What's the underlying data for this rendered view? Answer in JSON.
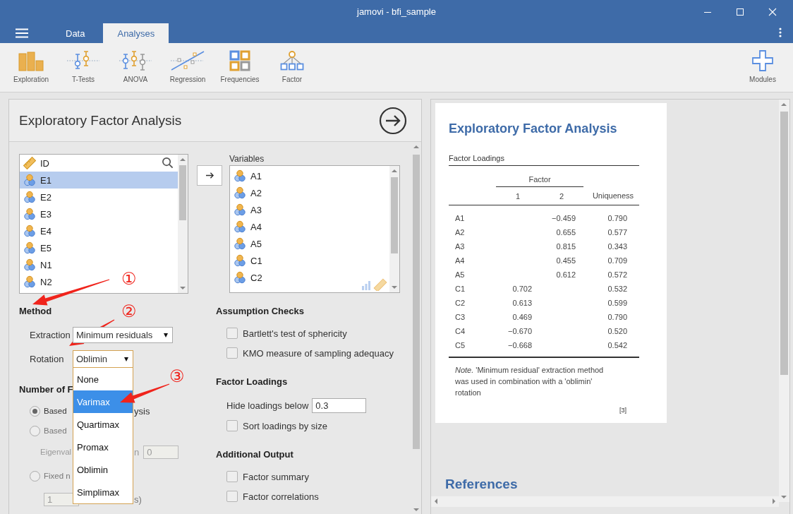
{
  "window": {
    "title": "jamovi - bfi_sample"
  },
  "menu_tabs": [
    {
      "label": "Data",
      "selected": false
    },
    {
      "label": "Analyses",
      "selected": true
    }
  ],
  "ribbon": [
    {
      "label": "Exploration",
      "kind": "exploration"
    },
    {
      "label": "T-Tests",
      "kind": "ttests"
    },
    {
      "label": "ANOVA",
      "kind": "anova"
    },
    {
      "label": "Regression",
      "kind": "regression"
    },
    {
      "label": "Frequencies",
      "kind": "frequencies"
    },
    {
      "label": "Factor",
      "kind": "factor"
    }
  ],
  "modules": {
    "label": "Modules"
  },
  "options_panel": {
    "title": "Exploratory Factor Analysis",
    "available_variables": [
      {
        "name": "ID",
        "kind": "id",
        "selected": false
      },
      {
        "name": "E1",
        "kind": "ordinal",
        "selected": true
      },
      {
        "name": "E2",
        "kind": "ordinal",
        "selected": false
      },
      {
        "name": "E3",
        "kind": "ordinal",
        "selected": false
      },
      {
        "name": "E4",
        "kind": "ordinal",
        "selected": false
      },
      {
        "name": "E5",
        "kind": "ordinal",
        "selected": false
      },
      {
        "name": "N1",
        "kind": "ordinal",
        "selected": false
      },
      {
        "name": "N2",
        "kind": "ordinal",
        "selected": false
      }
    ],
    "variables_label": "Variables",
    "variables": [
      {
        "name": "A1"
      },
      {
        "name": "A2"
      },
      {
        "name": "A3"
      },
      {
        "name": "A4"
      },
      {
        "name": "A5"
      },
      {
        "name": "C1"
      },
      {
        "name": "C2"
      }
    ],
    "method": {
      "heading": "Method",
      "extraction_label": "Extraction",
      "extraction_value": "Minimum residuals",
      "rotation_label": "Rotation",
      "rotation_value": "Oblimin",
      "rotation_options": [
        {
          "label": "None",
          "selected": false
        },
        {
          "label": "Varimax",
          "selected": true
        },
        {
          "label": "Quartimax",
          "selected": false
        },
        {
          "label": "Promax",
          "selected": false
        },
        {
          "label": "Oblimin",
          "selected": false
        },
        {
          "label": "Simplimax",
          "selected": false
        }
      ]
    },
    "number_of_factors": {
      "heading": "Number of F",
      "radios": [
        {
          "label": "Based",
          "tail": "ysis",
          "selected": true
        },
        {
          "label": "Based",
          "selected": false
        }
      ],
      "eigen": {
        "label": "Eigenval",
        "tail": "n",
        "value": "0"
      },
      "fixed": {
        "label": "Fixed n",
        "selected": false
      },
      "fixed_count": {
        "value": "1",
        "tail": "s)"
      }
    },
    "assumption_checks": {
      "heading": "Assumption Checks",
      "items": [
        {
          "label": "Bartlett's test of sphericity",
          "checked": false
        },
        {
          "label": "KMO measure of sampling adequacy",
          "checked": false
        }
      ]
    },
    "factor_loadings": {
      "heading": "Factor Loadings",
      "hide_label": "Hide loadings below",
      "hide_value": "0.3",
      "items": [
        {
          "label": "Sort loadings by size",
          "checked": false
        }
      ]
    },
    "additional_output": {
      "heading": "Additional Output",
      "items": [
        {
          "label": "Factor summary",
          "checked": false
        },
        {
          "label": "Factor correlations",
          "checked": false
        }
      ]
    }
  },
  "annotations": [
    {
      "label": "①"
    },
    {
      "label": "②"
    },
    {
      "label": "③"
    }
  ],
  "results": {
    "title": "Exploratory Factor Analysis",
    "table": {
      "title": "Factor Loadings",
      "group_header": "Factor",
      "columns": [
        "1",
        "2",
        "Uniqueness"
      ],
      "rows": [
        {
          "label": "A1",
          "factor_2": "−0.459",
          "uniqueness": "0.790"
        },
        {
          "label": "A2",
          "factor_2": "0.655",
          "uniqueness": "0.577"
        },
        {
          "label": "A3",
          "factor_2": "0.815",
          "uniqueness": "0.343"
        },
        {
          "label": "A4",
          "factor_2": "0.455",
          "uniqueness": "0.709"
        },
        {
          "label": "A5",
          "factor_2": "0.612",
          "uniqueness": "0.572"
        },
        {
          "label": "C1",
          "factor_1": "0.702",
          "uniqueness": "0.532"
        },
        {
          "label": "C2",
          "factor_1": "0.613",
          "uniqueness": "0.599"
        },
        {
          "label": "C3",
          "factor_1": "0.469",
          "uniqueness": "0.790"
        },
        {
          "label": "C4",
          "factor_1": "−0.670",
          "uniqueness": "0.520"
        },
        {
          "label": "C5",
          "factor_1": "−0.668",
          "uniqueness": "0.542"
        }
      ],
      "note": "*Note.* 'Minimum residual' extraction method was used in combination with a 'oblimin' rotation",
      "reference_mark": "[3]"
    },
    "references_heading": "References"
  }
}
